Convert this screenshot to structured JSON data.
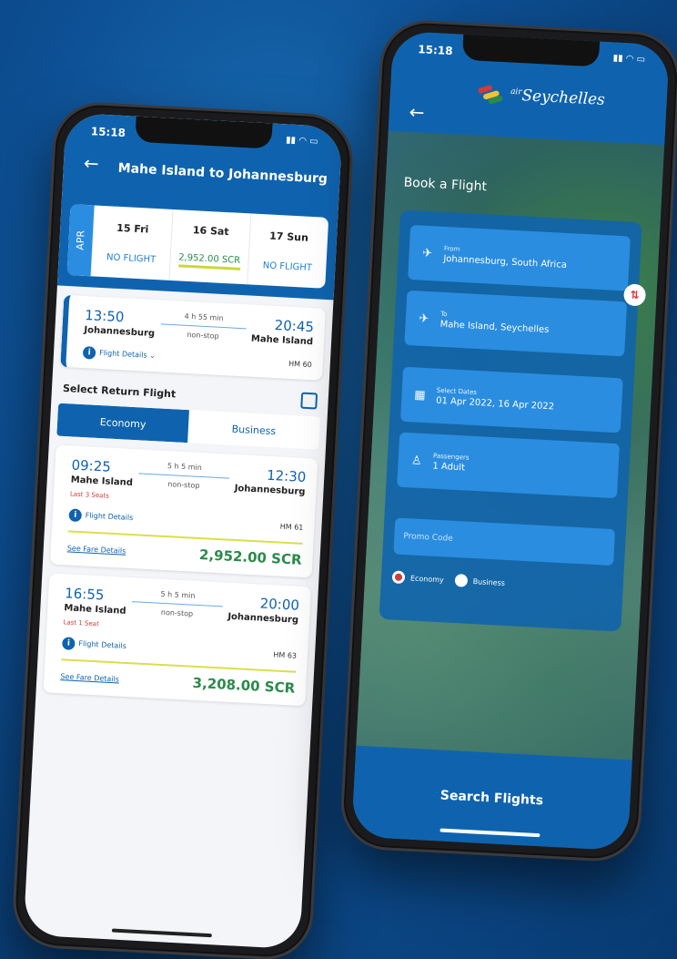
{
  "left_phone": {
    "status_time": "15:18",
    "route_title": "Mahe Island to Johannesburg",
    "month": "APR",
    "dates": [
      {
        "day": "15 Fri",
        "status": "NO FLIGHT"
      },
      {
        "day": "16 Sat",
        "status": "2,952.00 SCR"
      },
      {
        "day": "17 Sun",
        "status": "NO FLIGHT"
      }
    ],
    "selected_flight": {
      "dep_time": "13:50",
      "dep_city": "Johannesburg",
      "duration": "4 h 55 min",
      "stops": "non-stop",
      "arr_time": "20:45",
      "arr_city": "Mahe Island",
      "details_label": "Flight Details",
      "flight_no": "HM 60"
    },
    "section_title": "Select Return Flight",
    "cabin_tabs": [
      "Economy",
      "Business"
    ],
    "flights": [
      {
        "dep_time": "09:25",
        "dep_city": "Mahe Island",
        "duration": "5 h 5 min",
        "stops": "non-stop",
        "arr_time": "12:30",
        "arr_city": "Johannesburg",
        "seats": "Last 3 Seats",
        "details_label": "Flight Details",
        "flight_no": "HM 61",
        "fare_link": "See Fare Details",
        "price": "2,952.00 SCR"
      },
      {
        "dep_time": "16:55",
        "dep_city": "Mahe Island",
        "duration": "5 h 5 min",
        "stops": "non-stop",
        "arr_time": "20:00",
        "arr_city": "Johannesburg",
        "seats": "Last 1 Seat",
        "details_label": "Flight Details",
        "flight_no": "HM 63",
        "fare_link": "See Fare Details",
        "price": "3,208.00 SCR"
      }
    ]
  },
  "right_phone": {
    "status_time": "15:18",
    "logo_text_small": "air",
    "logo_text": "Seychelles",
    "page_title": "Book a Flight",
    "from": {
      "label": "From",
      "value": "Johannesburg, South Africa"
    },
    "to": {
      "label": "To",
      "value": "Mahe Island, Seychelles"
    },
    "dates": {
      "label": "Select Dates",
      "value": "01 Apr 2022, 16 Apr 2022"
    },
    "passengers": {
      "label": "Passengers",
      "value": "1 Adult"
    },
    "promo_placeholder": "Promo Code",
    "cabin_options": [
      "Economy",
      "Business"
    ],
    "search_button": "Search Flights"
  },
  "colors": {
    "brand_blue": "#0f63ae",
    "light_blue": "#2a8de0",
    "price_green": "#2a8a4a",
    "alert_red": "#d13a3a",
    "accent_lime": "#c9d935"
  }
}
